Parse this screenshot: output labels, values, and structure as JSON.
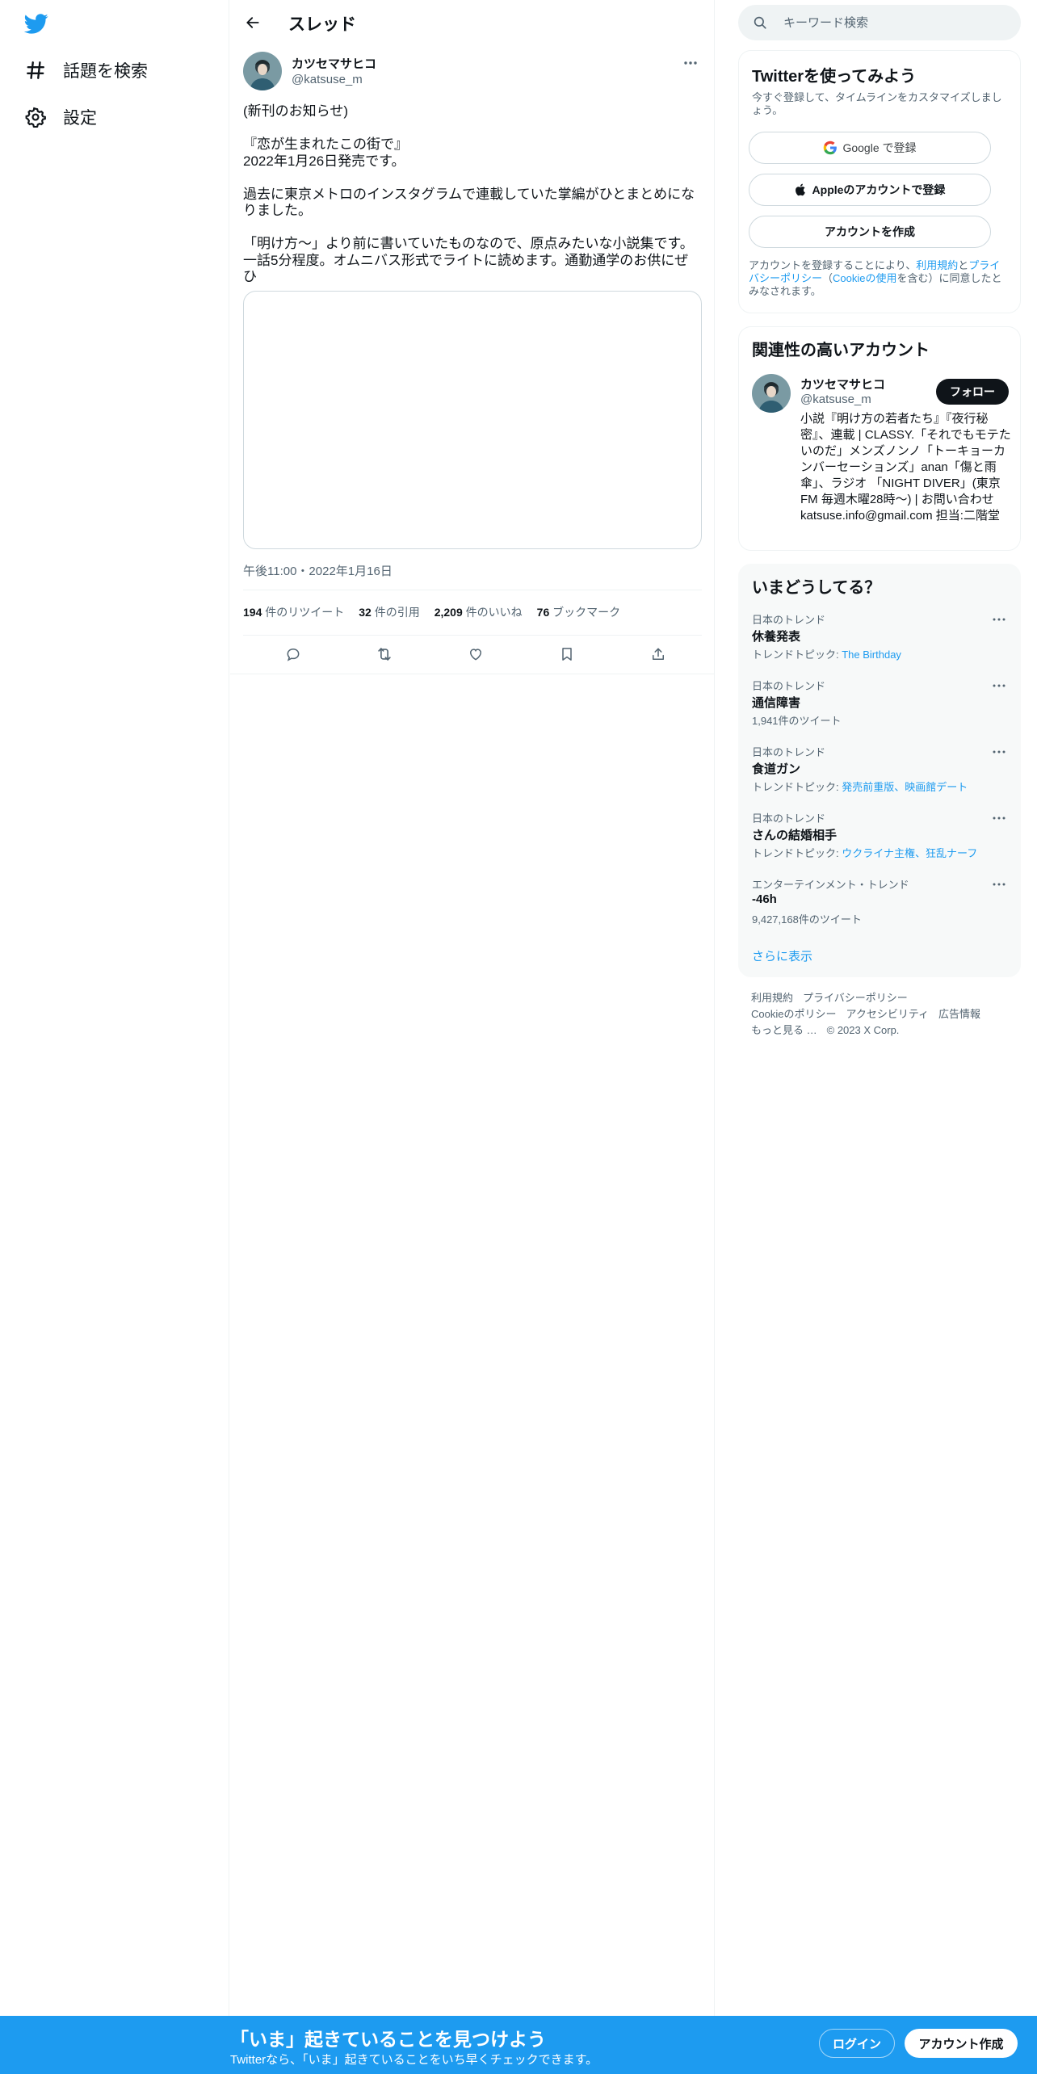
{
  "colors": {
    "accent": "#1d9bf0",
    "text": "#0f1419",
    "muted": "#536471",
    "border": "#eff3f4"
  },
  "sidebar": {
    "logo": "twitter-bird-icon",
    "items": [
      {
        "label": "話題を検索",
        "icon": "hashtag-icon"
      },
      {
        "label": "設定",
        "icon": "gear-icon"
      }
    ]
  },
  "header": {
    "title": "スレッド"
  },
  "tweet": {
    "author_name": "カツセマサヒコ",
    "author_handle": "@katsuse_m",
    "lines": [
      "(新刊のお知らせ)",
      "『恋が生まれたこの街で』",
      "2022年1月26日発売です。",
      "過去に東京メトロのインスタグラムで連載していた掌編がひとまとめになりました。",
      "「明け方〜」より前に書いていたものなので、原点みたいな小説集です。一話5分程度。オムニバス形式でライトに読めます。通勤通学のお供にぜひ"
    ],
    "timestamp": "午後11:00・2022年1月16日",
    "stats": {
      "retweets": {
        "count": "194",
        "label": "件のリツイート"
      },
      "quotes": {
        "count": "32",
        "label": "件の引用"
      },
      "likes": {
        "count": "2,209",
        "label": "件のいいね"
      },
      "bookmarks": {
        "count": "76",
        "label": "ブックマーク"
      }
    }
  },
  "search": {
    "placeholder": "キーワード検索"
  },
  "signup": {
    "title": "Twitterを使ってみよう",
    "subtitle": "今すぐ登録して、タイムラインをカスタマイズしましょう。",
    "google_label": "Google で登録",
    "apple_label": "Appleのアカウントで登録",
    "create_label": "アカウントを作成",
    "terms_prefix": "アカウントを登録することにより、",
    "terms_link1": "利用規約",
    "terms_and": "と",
    "terms_link2": "プライバシーポリシー",
    "terms_open": "（",
    "terms_link3": "Cookieの使用",
    "terms_suffix": "を含む）に同意したとみなされます。"
  },
  "related": {
    "title": "関連性の高いアカウント",
    "name": "カツセマサヒコ",
    "handle": "@katsuse_m",
    "follow_label": "フォロー",
    "bio": "小説『明け方の若者たち』『夜行秘密』、連載 | CLASSY.「それでもモテたいのだ」メンズノンノ「トーキョーカンバーセーションズ」anan「傷と雨傘」、ラジオ 「NIGHT DIVER」(東京FM 毎週木曜28時〜) | お問い合わせ katsuse.info@gmail.com 担当:二階堂"
  },
  "trends": {
    "title": "いまどうしてる？",
    "items": [
      {
        "context": "日本のトレンド",
        "name": "休養発表",
        "meta_prefix": "トレンドトピック: ",
        "meta_links": "The Birthday"
      },
      {
        "context": "日本のトレンド",
        "name": "通信障害",
        "meta_prefix": "1,941件のツイート",
        "meta_links": ""
      },
      {
        "context": "日本のトレンド",
        "name": "食道ガン",
        "meta_prefix": "トレンドトピック: ",
        "meta_links": "発売前重版、映画館デート"
      },
      {
        "context": "日本のトレンド",
        "name": "さんの結婚相手",
        "meta_prefix": "トレンドトピック: ",
        "meta_links": "ウクライナ主権、狂乱ナーフ"
      },
      {
        "context": "エンターテインメント・トレンド",
        "name": "-46h",
        "meta_prefix": "9,427,168件のツイート",
        "meta_links": ""
      }
    ],
    "show_more": "さらに表示"
  },
  "footer": {
    "links": [
      "利用規約",
      "プライバシーポリシー",
      "Cookieのポリシー",
      "アクセシビリティ",
      "広告情報",
      "もっと見る …"
    ],
    "copyright": "© 2023 X Corp."
  },
  "banner": {
    "title": "「いま」起きていることを見つけよう",
    "subtitle": "Twitterなら、「いま」起きていることをいち早くチェックできます。",
    "login_label": "ログイン",
    "create_label": "アカウント作成"
  }
}
